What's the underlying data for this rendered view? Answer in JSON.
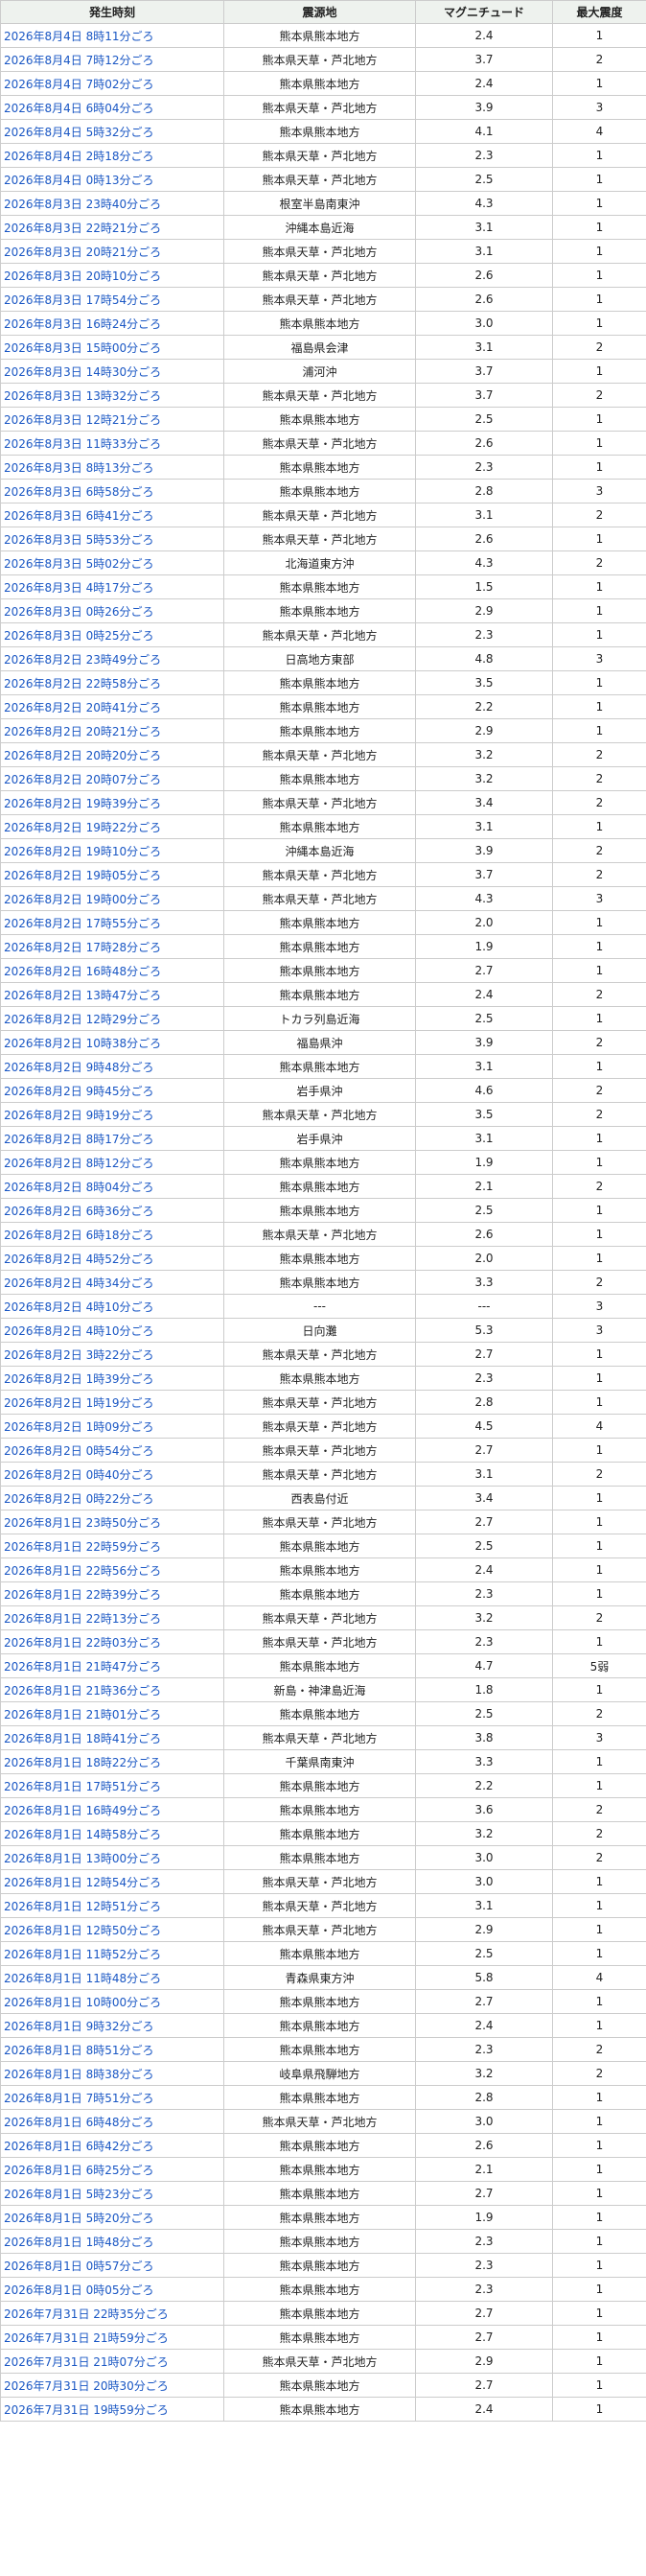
{
  "headers": [
    "発生時刻",
    "震源地",
    "マグニチュード",
    "最大震度"
  ],
  "rows": [
    [
      "2026年8月4日 8時11分ごろ",
      "熊本県熊本地方",
      "2.4",
      "1"
    ],
    [
      "2026年8月4日 7時12分ごろ",
      "熊本県天草・芦北地方",
      "3.7",
      "2"
    ],
    [
      "2026年8月4日 7時02分ごろ",
      "熊本県熊本地方",
      "2.4",
      "1"
    ],
    [
      "2026年8月4日 6時04分ごろ",
      "熊本県天草・芦北地方",
      "3.9",
      "3"
    ],
    [
      "2026年8月4日 5時32分ごろ",
      "熊本県熊本地方",
      "4.1",
      "4"
    ],
    [
      "2026年8月4日 2時18分ごろ",
      "熊本県天草・芦北地方",
      "2.3",
      "1"
    ],
    [
      "2026年8月4日 0時13分ごろ",
      "熊本県天草・芦北地方",
      "2.5",
      "1"
    ],
    [
      "2026年8月3日 23時40分ごろ",
      "根室半島南東沖",
      "4.3",
      "1"
    ],
    [
      "2026年8月3日 22時21分ごろ",
      "沖縄本島近海",
      "3.1",
      "1"
    ],
    [
      "2026年8月3日 20時21分ごろ",
      "熊本県天草・芦北地方",
      "3.1",
      "1"
    ],
    [
      "2026年8月3日 20時10分ごろ",
      "熊本県天草・芦北地方",
      "2.6",
      "1"
    ],
    [
      "2026年8月3日 17時54分ごろ",
      "熊本県天草・芦北地方",
      "2.6",
      "1"
    ],
    [
      "2026年8月3日 16時24分ごろ",
      "熊本県熊本地方",
      "3.0",
      "1"
    ],
    [
      "2026年8月3日 15時00分ごろ",
      "福島県会津",
      "3.1",
      "2"
    ],
    [
      "2026年8月3日 14時30分ごろ",
      "浦河沖",
      "3.7",
      "1"
    ],
    [
      "2026年8月3日 13時32分ごろ",
      "熊本県天草・芦北地方",
      "3.7",
      "2"
    ],
    [
      "2026年8月3日 12時21分ごろ",
      "熊本県熊本地方",
      "2.5",
      "1"
    ],
    [
      "2026年8月3日 11時33分ごろ",
      "熊本県天草・芦北地方",
      "2.6",
      "1"
    ],
    [
      "2026年8月3日 8時13分ごろ",
      "熊本県熊本地方",
      "2.3",
      "1"
    ],
    [
      "2026年8月3日 6時58分ごろ",
      "熊本県熊本地方",
      "2.8",
      "3"
    ],
    [
      "2026年8月3日 6時41分ごろ",
      "熊本県天草・芦北地方",
      "3.1",
      "2"
    ],
    [
      "2026年8月3日 5時53分ごろ",
      "熊本県天草・芦北地方",
      "2.6",
      "1"
    ],
    [
      "2026年8月3日 5時02分ごろ",
      "北海道東方沖",
      "4.3",
      "2"
    ],
    [
      "2026年8月3日 4時17分ごろ",
      "熊本県熊本地方",
      "1.5",
      "1"
    ],
    [
      "2026年8月3日 0時26分ごろ",
      "熊本県熊本地方",
      "2.9",
      "1"
    ],
    [
      "2026年8月3日 0時25分ごろ",
      "熊本県天草・芦北地方",
      "2.3",
      "1"
    ],
    [
      "2026年8月2日 23時49分ごろ",
      "日高地方東部",
      "4.8",
      "3"
    ],
    [
      "2026年8月2日 22時58分ごろ",
      "熊本県熊本地方",
      "3.5",
      "1"
    ],
    [
      "2026年8月2日 20時41分ごろ",
      "熊本県熊本地方",
      "2.2",
      "1"
    ],
    [
      "2026年8月2日 20時21分ごろ",
      "熊本県熊本地方",
      "2.9",
      "1"
    ],
    [
      "2026年8月2日 20時20分ごろ",
      "熊本県天草・芦北地方",
      "3.2",
      "2"
    ],
    [
      "2026年8月2日 20時07分ごろ",
      "熊本県熊本地方",
      "3.2",
      "2"
    ],
    [
      "2026年8月2日 19時39分ごろ",
      "熊本県天草・芦北地方",
      "3.4",
      "2"
    ],
    [
      "2026年8月2日 19時22分ごろ",
      "熊本県熊本地方",
      "3.1",
      "1"
    ],
    [
      "2026年8月2日 19時10分ごろ",
      "沖縄本島近海",
      "3.9",
      "2"
    ],
    [
      "2026年8月2日 19時05分ごろ",
      "熊本県天草・芦北地方",
      "3.7",
      "2"
    ],
    [
      "2026年8月2日 19時00分ごろ",
      "熊本県天草・芦北地方",
      "4.3",
      "3"
    ],
    [
      "2026年8月2日 17時55分ごろ",
      "熊本県熊本地方",
      "2.0",
      "1"
    ],
    [
      "2026年8月2日 17時28分ごろ",
      "熊本県熊本地方",
      "1.9",
      "1"
    ],
    [
      "2026年8月2日 16時48分ごろ",
      "熊本県熊本地方",
      "2.7",
      "1"
    ],
    [
      "2026年8月2日 13時47分ごろ",
      "熊本県熊本地方",
      "2.4",
      "2"
    ],
    [
      "2026年8月2日 12時29分ごろ",
      "トカラ列島近海",
      "2.5",
      "1"
    ],
    [
      "2026年8月2日 10時38分ごろ",
      "福島県沖",
      "3.9",
      "2"
    ],
    [
      "2026年8月2日 9時48分ごろ",
      "熊本県熊本地方",
      "3.1",
      "1"
    ],
    [
      "2026年8月2日 9時45分ごろ",
      "岩手県沖",
      "4.6",
      "2"
    ],
    [
      "2026年8月2日 9時19分ごろ",
      "熊本県天草・芦北地方",
      "3.5",
      "2"
    ],
    [
      "2026年8月2日 8時17分ごろ",
      "岩手県沖",
      "3.1",
      "1"
    ],
    [
      "2026年8月2日 8時12分ごろ",
      "熊本県熊本地方",
      "1.9",
      "1"
    ],
    [
      "2026年8月2日 8時04分ごろ",
      "熊本県熊本地方",
      "2.1",
      "2"
    ],
    [
      "2026年8月2日 6時36分ごろ",
      "熊本県熊本地方",
      "2.5",
      "1"
    ],
    [
      "2026年8月2日 6時18分ごろ",
      "熊本県天草・芦北地方",
      "2.6",
      "1"
    ],
    [
      "2026年8月2日 4時52分ごろ",
      "熊本県熊本地方",
      "2.0",
      "1"
    ],
    [
      "2026年8月2日 4時34分ごろ",
      "熊本県熊本地方",
      "3.3",
      "2"
    ],
    [
      "2026年8月2日 4時10分ごろ",
      "---",
      "---",
      "3"
    ],
    [
      "2026年8月2日 4時10分ごろ",
      "日向灘",
      "5.3",
      "3"
    ],
    [
      "2026年8月2日 3時22分ごろ",
      "熊本県天草・芦北地方",
      "2.7",
      "1"
    ],
    [
      "2026年8月2日 1時39分ごろ",
      "熊本県熊本地方",
      "2.3",
      "1"
    ],
    [
      "2026年8月2日 1時19分ごろ",
      "熊本県天草・芦北地方",
      "2.8",
      "1"
    ],
    [
      "2026年8月2日 1時09分ごろ",
      "熊本県天草・芦北地方",
      "4.5",
      "4"
    ],
    [
      "2026年8月2日 0時54分ごろ",
      "熊本県天草・芦北地方",
      "2.7",
      "1"
    ],
    [
      "2026年8月2日 0時40分ごろ",
      "熊本県天草・芦北地方",
      "3.1",
      "2"
    ],
    [
      "2026年8月2日 0時22分ごろ",
      "西表島付近",
      "3.4",
      "1"
    ],
    [
      "2026年8月1日 23時50分ごろ",
      "熊本県天草・芦北地方",
      "2.7",
      "1"
    ],
    [
      "2026年8月1日 22時59分ごろ",
      "熊本県熊本地方",
      "2.5",
      "1"
    ],
    [
      "2026年8月1日 22時56分ごろ",
      "熊本県熊本地方",
      "2.4",
      "1"
    ],
    [
      "2026年8月1日 22時39分ごろ",
      "熊本県熊本地方",
      "2.3",
      "1"
    ],
    [
      "2026年8月1日 22時13分ごろ",
      "熊本県天草・芦北地方",
      "3.2",
      "2"
    ],
    [
      "2026年8月1日 22時03分ごろ",
      "熊本県天草・芦北地方",
      "2.3",
      "1"
    ],
    [
      "2026年8月1日 21時47分ごろ",
      "熊本県熊本地方",
      "4.7",
      "5弱"
    ],
    [
      "2026年8月1日 21時36分ごろ",
      "新島・神津島近海",
      "1.8",
      "1"
    ],
    [
      "2026年8月1日 21時01分ごろ",
      "熊本県熊本地方",
      "2.5",
      "2"
    ],
    [
      "2026年8月1日 18時41分ごろ",
      "熊本県天草・芦北地方",
      "3.8",
      "3"
    ],
    [
      "2026年8月1日 18時22分ごろ",
      "千葉県南東沖",
      "3.3",
      "1"
    ],
    [
      "2026年8月1日 17時51分ごろ",
      "熊本県熊本地方",
      "2.2",
      "1"
    ],
    [
      "2026年8月1日 16時49分ごろ",
      "熊本県熊本地方",
      "3.6",
      "2"
    ],
    [
      "2026年8月1日 14時58分ごろ",
      "熊本県熊本地方",
      "3.2",
      "2"
    ],
    [
      "2026年8月1日 13時00分ごろ",
      "熊本県熊本地方",
      "3.0",
      "2"
    ],
    [
      "2026年8月1日 12時54分ごろ",
      "熊本県天草・芦北地方",
      "3.0",
      "1"
    ],
    [
      "2026年8月1日 12時51分ごろ",
      "熊本県天草・芦北地方",
      "3.1",
      "1"
    ],
    [
      "2026年8月1日 12時50分ごろ",
      "熊本県天草・芦北地方",
      "2.9",
      "1"
    ],
    [
      "2026年8月1日 11時52分ごろ",
      "熊本県熊本地方",
      "2.5",
      "1"
    ],
    [
      "2026年8月1日 11時48分ごろ",
      "青森県東方沖",
      "5.8",
      "4"
    ],
    [
      "2026年8月1日 10時00分ごろ",
      "熊本県熊本地方",
      "2.7",
      "1"
    ],
    [
      "2026年8月1日 9時32分ごろ",
      "熊本県熊本地方",
      "2.4",
      "1"
    ],
    [
      "2026年8月1日 8時51分ごろ",
      "熊本県熊本地方",
      "2.3",
      "2"
    ],
    [
      "2026年8月1日 8時38分ごろ",
      "岐阜県飛騨地方",
      "3.2",
      "2"
    ],
    [
      "2026年8月1日 7時51分ごろ",
      "熊本県熊本地方",
      "2.8",
      "1"
    ],
    [
      "2026年8月1日 6時48分ごろ",
      "熊本県天草・芦北地方",
      "3.0",
      "1"
    ],
    [
      "2026年8月1日 6時42分ごろ",
      "熊本県熊本地方",
      "2.6",
      "1"
    ],
    [
      "2026年8月1日 6時25分ごろ",
      "熊本県熊本地方",
      "2.1",
      "1"
    ],
    [
      "2026年8月1日 5時23分ごろ",
      "熊本県熊本地方",
      "2.7",
      "1"
    ],
    [
      "2026年8月1日 5時20分ごろ",
      "熊本県熊本地方",
      "1.9",
      "1"
    ],
    [
      "2026年8月1日 1時48分ごろ",
      "熊本県熊本地方",
      "2.3",
      "1"
    ],
    [
      "2026年8月1日 0時57分ごろ",
      "熊本県熊本地方",
      "2.3",
      "1"
    ],
    [
      "2026年8月1日 0時05分ごろ",
      "熊本県熊本地方",
      "2.3",
      "1"
    ],
    [
      "2026年7月31日 22時35分ごろ",
      "熊本県熊本地方",
      "2.7",
      "1"
    ],
    [
      "2026年7月31日 21時59分ごろ",
      "熊本県熊本地方",
      "2.7",
      "1"
    ],
    [
      "2026年7月31日 21時07分ごろ",
      "熊本県天草・芦北地方",
      "2.9",
      "1"
    ],
    [
      "2026年7月31日 20時30分ごろ",
      "熊本県熊本地方",
      "2.7",
      "1"
    ],
    [
      "2026年7月31日 19時59分ごろ",
      "熊本県熊本地方",
      "2.4",
      "1"
    ]
  ]
}
